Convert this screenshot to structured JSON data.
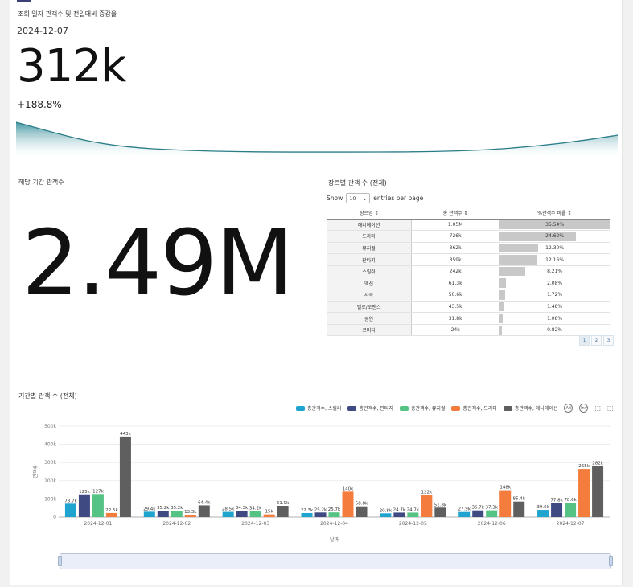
{
  "kpi": {
    "title": "조회 일자 관객수 및 전일대비 증감율",
    "date": "2024-12-07",
    "value": "312k",
    "delta": "+188.8%"
  },
  "period": {
    "title": "해당 기간 관객수",
    "value": "2.49M"
  },
  "genre_table": {
    "title": "장르별 관객 수 (전체)",
    "show_label": "Show",
    "entries_value": "10",
    "entries_label": "entries per page",
    "headers": [
      "장르명 ⇕",
      "총 관객수 ⇕",
      "%관객수 비율 ⇕"
    ],
    "rows": [
      {
        "genre": "애니메이션",
        "total": "1.05M",
        "pct": "35.54%",
        "frac": 0.3554
      },
      {
        "genre": "드라마",
        "total": "726k",
        "pct": "24.62%",
        "frac": 0.2462
      },
      {
        "genre": "뮤지컬",
        "total": "362k",
        "pct": "12.30%",
        "frac": 0.123
      },
      {
        "genre": "판타지",
        "total": "359k",
        "pct": "12.16%",
        "frac": 0.1216
      },
      {
        "genre": "스릴러",
        "total": "242k",
        "pct": "8.21%",
        "frac": 0.0821
      },
      {
        "genre": "액션",
        "total": "61.3k",
        "pct": "2.08%",
        "frac": 0.0208
      },
      {
        "genre": "사극",
        "total": "50.6k",
        "pct": "1.72%",
        "frac": 0.0172
      },
      {
        "genre": "멜로/로맨스",
        "total": "43.5k",
        "pct": "1.48%",
        "frac": 0.0148
      },
      {
        "genre": "공연",
        "total": "31.8k",
        "pct": "1.08%",
        "frac": 0.0108
      },
      {
        "genre": "코미디",
        "total": "24k",
        "pct": "0.82%",
        "frac": 0.0082
      }
    ],
    "pages": [
      "1",
      "2",
      "3"
    ]
  },
  "legend_tools": {
    "alt": "Alt",
    "inv": "Inv"
  },
  "chart_data": {
    "type": "bar",
    "title": "기간별 관객 수 (전체)",
    "xlabel": "날짜",
    "ylabel": "관객수",
    "ylim": [
      0,
      500000
    ],
    "yticks": [
      "0",
      "100k",
      "200k",
      "300k",
      "400k",
      "500k"
    ],
    "grid": true,
    "legend_position": "top-right",
    "categories": [
      "2024-12-01",
      "2024-12-02",
      "2024-12-03",
      "2024-12-04",
      "2024-12-05",
      "2024-12-06",
      "2024-12-07"
    ],
    "series": [
      {
        "name": "총관객수, 스릴러",
        "color": "#1fa3cf",
        "values": [
          73700,
          29400,
          28500,
          22300,
          20800,
          27900,
          39600
        ],
        "labels": [
          "73.7k",
          "29.4k",
          "28.5k",
          "22.3k",
          "20.8k",
          "27.9k",
          "39.6k"
        ]
      },
      {
        "name": "총관객수, 판타지",
        "color": "#3f4a83",
        "values": [
          125000,
          35200,
          34300,
          25200,
          24700,
          36700,
          77800
        ],
        "labels": [
          "125k",
          "35.2k",
          "34.3k",
          "25.2k",
          "24.7k",
          "36.7k",
          "77.8k"
        ]
      },
      {
        "name": "총관객수, 뮤지컬",
        "color": "#55c383",
        "values": [
          127000,
          35200,
          34200,
          25700,
          24700,
          37300,
          78600
        ],
        "labels": [
          "127k",
          "35.2k",
          "34.2k",
          "25.7k",
          "24.7k",
          "37.3k",
          "78.6k"
        ]
      },
      {
        "name": "총관객수, 드라마",
        "color": "#f47c3c",
        "values": [
          22500,
          13300,
          15000,
          140000,
          122000,
          148000,
          265000
        ],
        "labels": [
          "22.5k",
          "13.3k",
          "15k",
          "140k",
          "122k",
          "148k",
          "265k"
        ]
      },
      {
        "name": "총관객수, 애니메이션",
        "color": "#5f5f5f",
        "values": [
          443000,
          64400,
          61900,
          58800,
          51800,
          85400,
          282000
        ],
        "labels": [
          "443k",
          "64.4k",
          "61.9k",
          "58.8k",
          "51.8k",
          "85.4k",
          "282k"
        ]
      }
    ]
  }
}
